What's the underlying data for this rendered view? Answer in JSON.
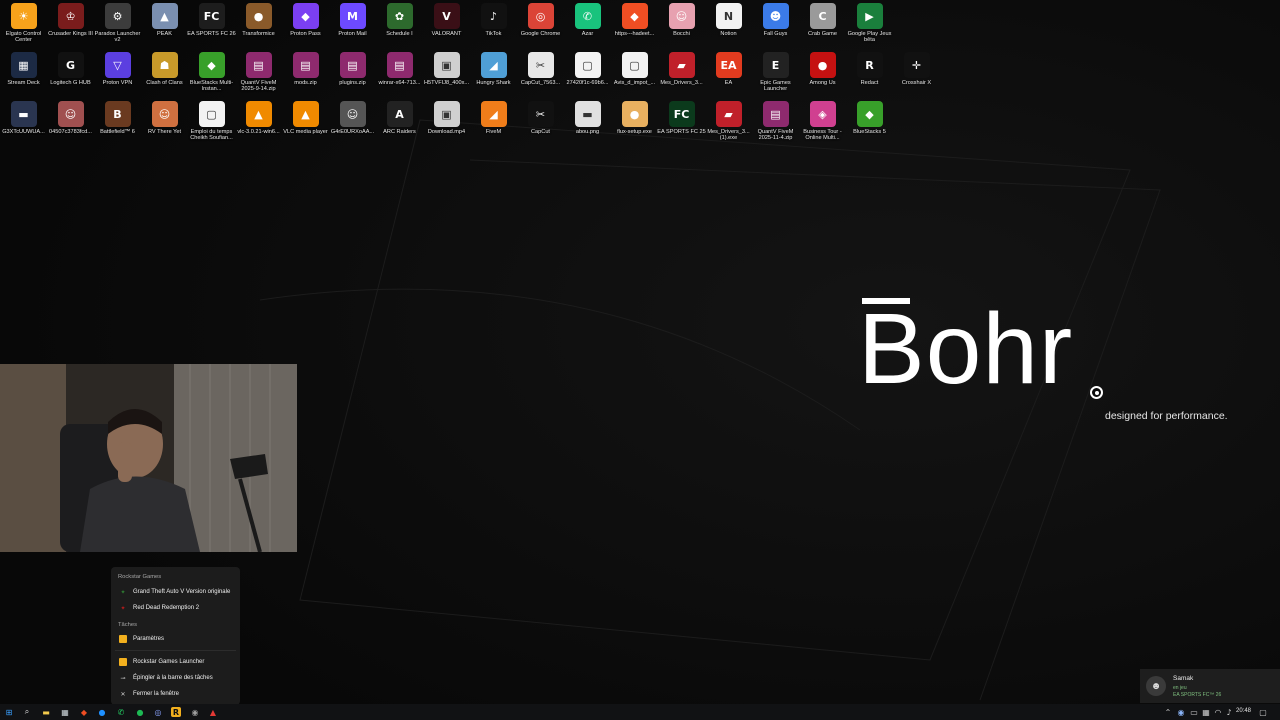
{
  "desktop": {
    "icons": [
      {
        "label": "Elgato Control Center",
        "glyph": "☀",
        "color": "#f7a21b"
      },
      {
        "label": "Crusader Kings III",
        "glyph": "♔",
        "color": "#7a1c1c"
      },
      {
        "label": "Paradox Launcher v2",
        "glyph": "⚙",
        "color": "#3c3c3c"
      },
      {
        "label": "PEAK",
        "glyph": "▲",
        "color": "#7a8fb0"
      },
      {
        "label": "EA SPORTS FC 26",
        "glyph": "FC",
        "color": "#1d1d1d"
      },
      {
        "label": "Transformice",
        "glyph": "●",
        "color": "#8a5a2a"
      },
      {
        "label": "Proton Pass",
        "glyph": "◆",
        "color": "#7b3ff2"
      },
      {
        "label": "Proton Mail",
        "glyph": "M",
        "color": "#6d4aff"
      },
      {
        "label": "Schedule I",
        "glyph": "✿",
        "color": "#2d6a2d"
      },
      {
        "label": "VALORANT",
        "glyph": "V",
        "color": "#3a0f16"
      },
      {
        "label": "TikTok",
        "glyph": "♪",
        "color": "#111"
      },
      {
        "label": "Google Chrome",
        "glyph": "◎",
        "color": "#db4437"
      },
      {
        "label": "Azar",
        "glyph": "✆",
        "color": "#19c37d"
      },
      {
        "label": "https---hadeet...",
        "glyph": "◆",
        "color": "#f04e23"
      },
      {
        "label": "Bocchi",
        "glyph": "☺",
        "color": "#e7a1b0"
      },
      {
        "label": "Notion",
        "glyph": "N",
        "color": "#f2f2f2"
      },
      {
        "label": "Fall Guys",
        "glyph": "☻",
        "color": "#3b7be8"
      },
      {
        "label": "Crab Game",
        "glyph": "C",
        "color": "#9a9a9a"
      },
      {
        "label": "Google Play Jeux bêta",
        "glyph": "▶",
        "color": "#1a7f3c"
      },
      {
        "label": "Stream Deck",
        "glyph": "▦",
        "color": "#1c2a44"
      },
      {
        "label": "Logitech G HUB",
        "glyph": "G",
        "color": "#111"
      },
      {
        "label": "Proton VPN",
        "glyph": "▽",
        "color": "#5b3fe0"
      },
      {
        "label": "Clash of Clans",
        "glyph": "☗",
        "color": "#c89a2a"
      },
      {
        "label": "BlueStacks Multi-Instan...",
        "glyph": "◆",
        "color": "#38a02a"
      },
      {
        "label": "QuantV FiveM 2025-9-14.zip",
        "glyph": "▤",
        "color": "#8e2a6e"
      },
      {
        "label": "mods.zip",
        "glyph": "▤",
        "color": "#8e2a6e"
      },
      {
        "label": "plugins.zip",
        "glyph": "▤",
        "color": "#8e2a6e"
      },
      {
        "label": "winrar-x64-713...",
        "glyph": "▤",
        "color": "#8e2a6e"
      },
      {
        "label": "H5TVFIJ8_400x...",
        "glyph": "▣",
        "color": "#cfcfcf"
      },
      {
        "label": "Hungry Shark",
        "glyph": "◢",
        "color": "#4f9fd6"
      },
      {
        "label": "CapCut_7563...",
        "glyph": "✂",
        "color": "#e8e8e8"
      },
      {
        "label": "27420f1c-69b6...",
        "glyph": "▢",
        "color": "#f3f3f3"
      },
      {
        "label": "Avis_d_impot_...",
        "glyph": "▢",
        "color": "#f3f3f3"
      },
      {
        "label": "Mes_Drivers_3...",
        "glyph": "▰",
        "color": "#c0202a"
      },
      {
        "label": "EA",
        "glyph": "EA",
        "color": "#e23b1f"
      },
      {
        "label": "Epic Games Launcher",
        "glyph": "E",
        "color": "#222"
      },
      {
        "label": "Among Us",
        "glyph": "●",
        "color": "#c51111"
      },
      {
        "label": "Redact",
        "glyph": "R",
        "color": "#111"
      },
      {
        "label": "Crosshair X",
        "glyph": "✛",
        "color": "#111"
      },
      {
        "label": "G3XTcUUWUA...",
        "glyph": "▬",
        "color": "#2a3550"
      },
      {
        "label": "04507c3783fcd...",
        "glyph": "☺",
        "color": "#a05050"
      },
      {
        "label": "Battlefield™ 6",
        "glyph": "B",
        "color": "#6a3a20"
      },
      {
        "label": "RV There Yet",
        "glyph": "☺",
        "color": "#d07040"
      },
      {
        "label": "Emploi du temps Cheikh Soufian...",
        "glyph": "▢",
        "color": "#f3f3f3"
      },
      {
        "label": "vlc-3.0.21-win6...",
        "glyph": "▲",
        "color": "#f08a00"
      },
      {
        "label": "VLC media player",
        "glyph": "▲",
        "color": "#f08a00"
      },
      {
        "label": "G4rE0URXoAA...",
        "glyph": "☺",
        "color": "#555"
      },
      {
        "label": "ARC Raiders",
        "glyph": "A",
        "color": "#222"
      },
      {
        "label": "Download.mp4",
        "glyph": "▣",
        "color": "#d0d0d0"
      },
      {
        "label": "FiveM",
        "glyph": "◢",
        "color": "#f07d1a"
      },
      {
        "label": "CapCut",
        "glyph": "✂",
        "color": "#111"
      },
      {
        "label": "abou.png",
        "glyph": "▬",
        "color": "#e0e0e0"
      },
      {
        "label": "flux-setup.exe",
        "glyph": "●",
        "color": "#e8b060"
      },
      {
        "label": "EA SPORTS FC 25",
        "glyph": "FC",
        "color": "#0b3a1c"
      },
      {
        "label": "Mes_Drivers_3... (1).exe",
        "glyph": "▰",
        "color": "#c0202a"
      },
      {
        "label": "QuantV FiveM 2025-11-4.zip",
        "glyph": "▤",
        "color": "#8e2a6e"
      },
      {
        "label": "Business Tour - Online Multi...",
        "glyph": "◈",
        "color": "#d04090"
      },
      {
        "label": "BlueStacks 5",
        "glyph": "◆",
        "color": "#38a02a"
      }
    ]
  },
  "wallpaper": {
    "brand": "Bohr",
    "brand_dot": ".",
    "tagline": "designed for performance."
  },
  "jumplist": {
    "section_app": "Rockstar Games",
    "recent": [
      {
        "label": "Grand Theft Auto V Version originale",
        "glyph": "✦",
        "color": "#2e7d32"
      },
      {
        "label": "Red Dead Redemption 2",
        "glyph": "✦",
        "color": "#b71c1c"
      }
    ],
    "section_tasks": "Tâches",
    "tasks": [
      {
        "label": "Paramètres",
        "glyph": "▪",
        "color": "#f2b01e"
      }
    ],
    "actions": [
      {
        "label": "Rockstar Games Launcher",
        "glyph": "▪",
        "color": "#f2b01e"
      },
      {
        "label": "Épingler à la barre des tâches",
        "glyph": "⊸",
        "color": "#cfcfcf"
      },
      {
        "label": "Fermer la fenêtre",
        "glyph": "✕",
        "color": "#cfcfcf"
      }
    ]
  },
  "taskbar": {
    "apps": [
      {
        "name": "start-button",
        "glyph": "⊞",
        "color": "#3aa0ff"
      },
      {
        "name": "search-icon",
        "glyph": "⌕",
        "color": "#e0e0e0"
      },
      {
        "name": "file-explorer-icon",
        "glyph": "▬",
        "color": "#f2c94c"
      },
      {
        "name": "calculator-icon",
        "glyph": "▦",
        "color": "#cfd8dc"
      },
      {
        "name": "brave-icon",
        "glyph": "◆",
        "color": "#f04e23"
      },
      {
        "name": "edge-icon",
        "glyph": "●",
        "color": "#1e90ff"
      },
      {
        "name": "whatsapp-icon",
        "glyph": "✆",
        "color": "#25d366"
      },
      {
        "name": "spotify-icon",
        "glyph": "●",
        "color": "#1db954"
      },
      {
        "name": "chrome-icon",
        "glyph": "◎",
        "color": "#8aa4ff"
      },
      {
        "name": "rockstar-icon",
        "glyph": "R",
        "color": "#f2b01e"
      },
      {
        "name": "obs-icon",
        "glyph": "◉",
        "color": "#9e9e9e"
      },
      {
        "name": "app-icon",
        "glyph": "▲",
        "color": "#e53935"
      }
    ],
    "notification": {
      "user": "Samak",
      "status": "en jeu",
      "game": "EA SPORTS FC™ 26"
    },
    "time": "20:48"
  }
}
